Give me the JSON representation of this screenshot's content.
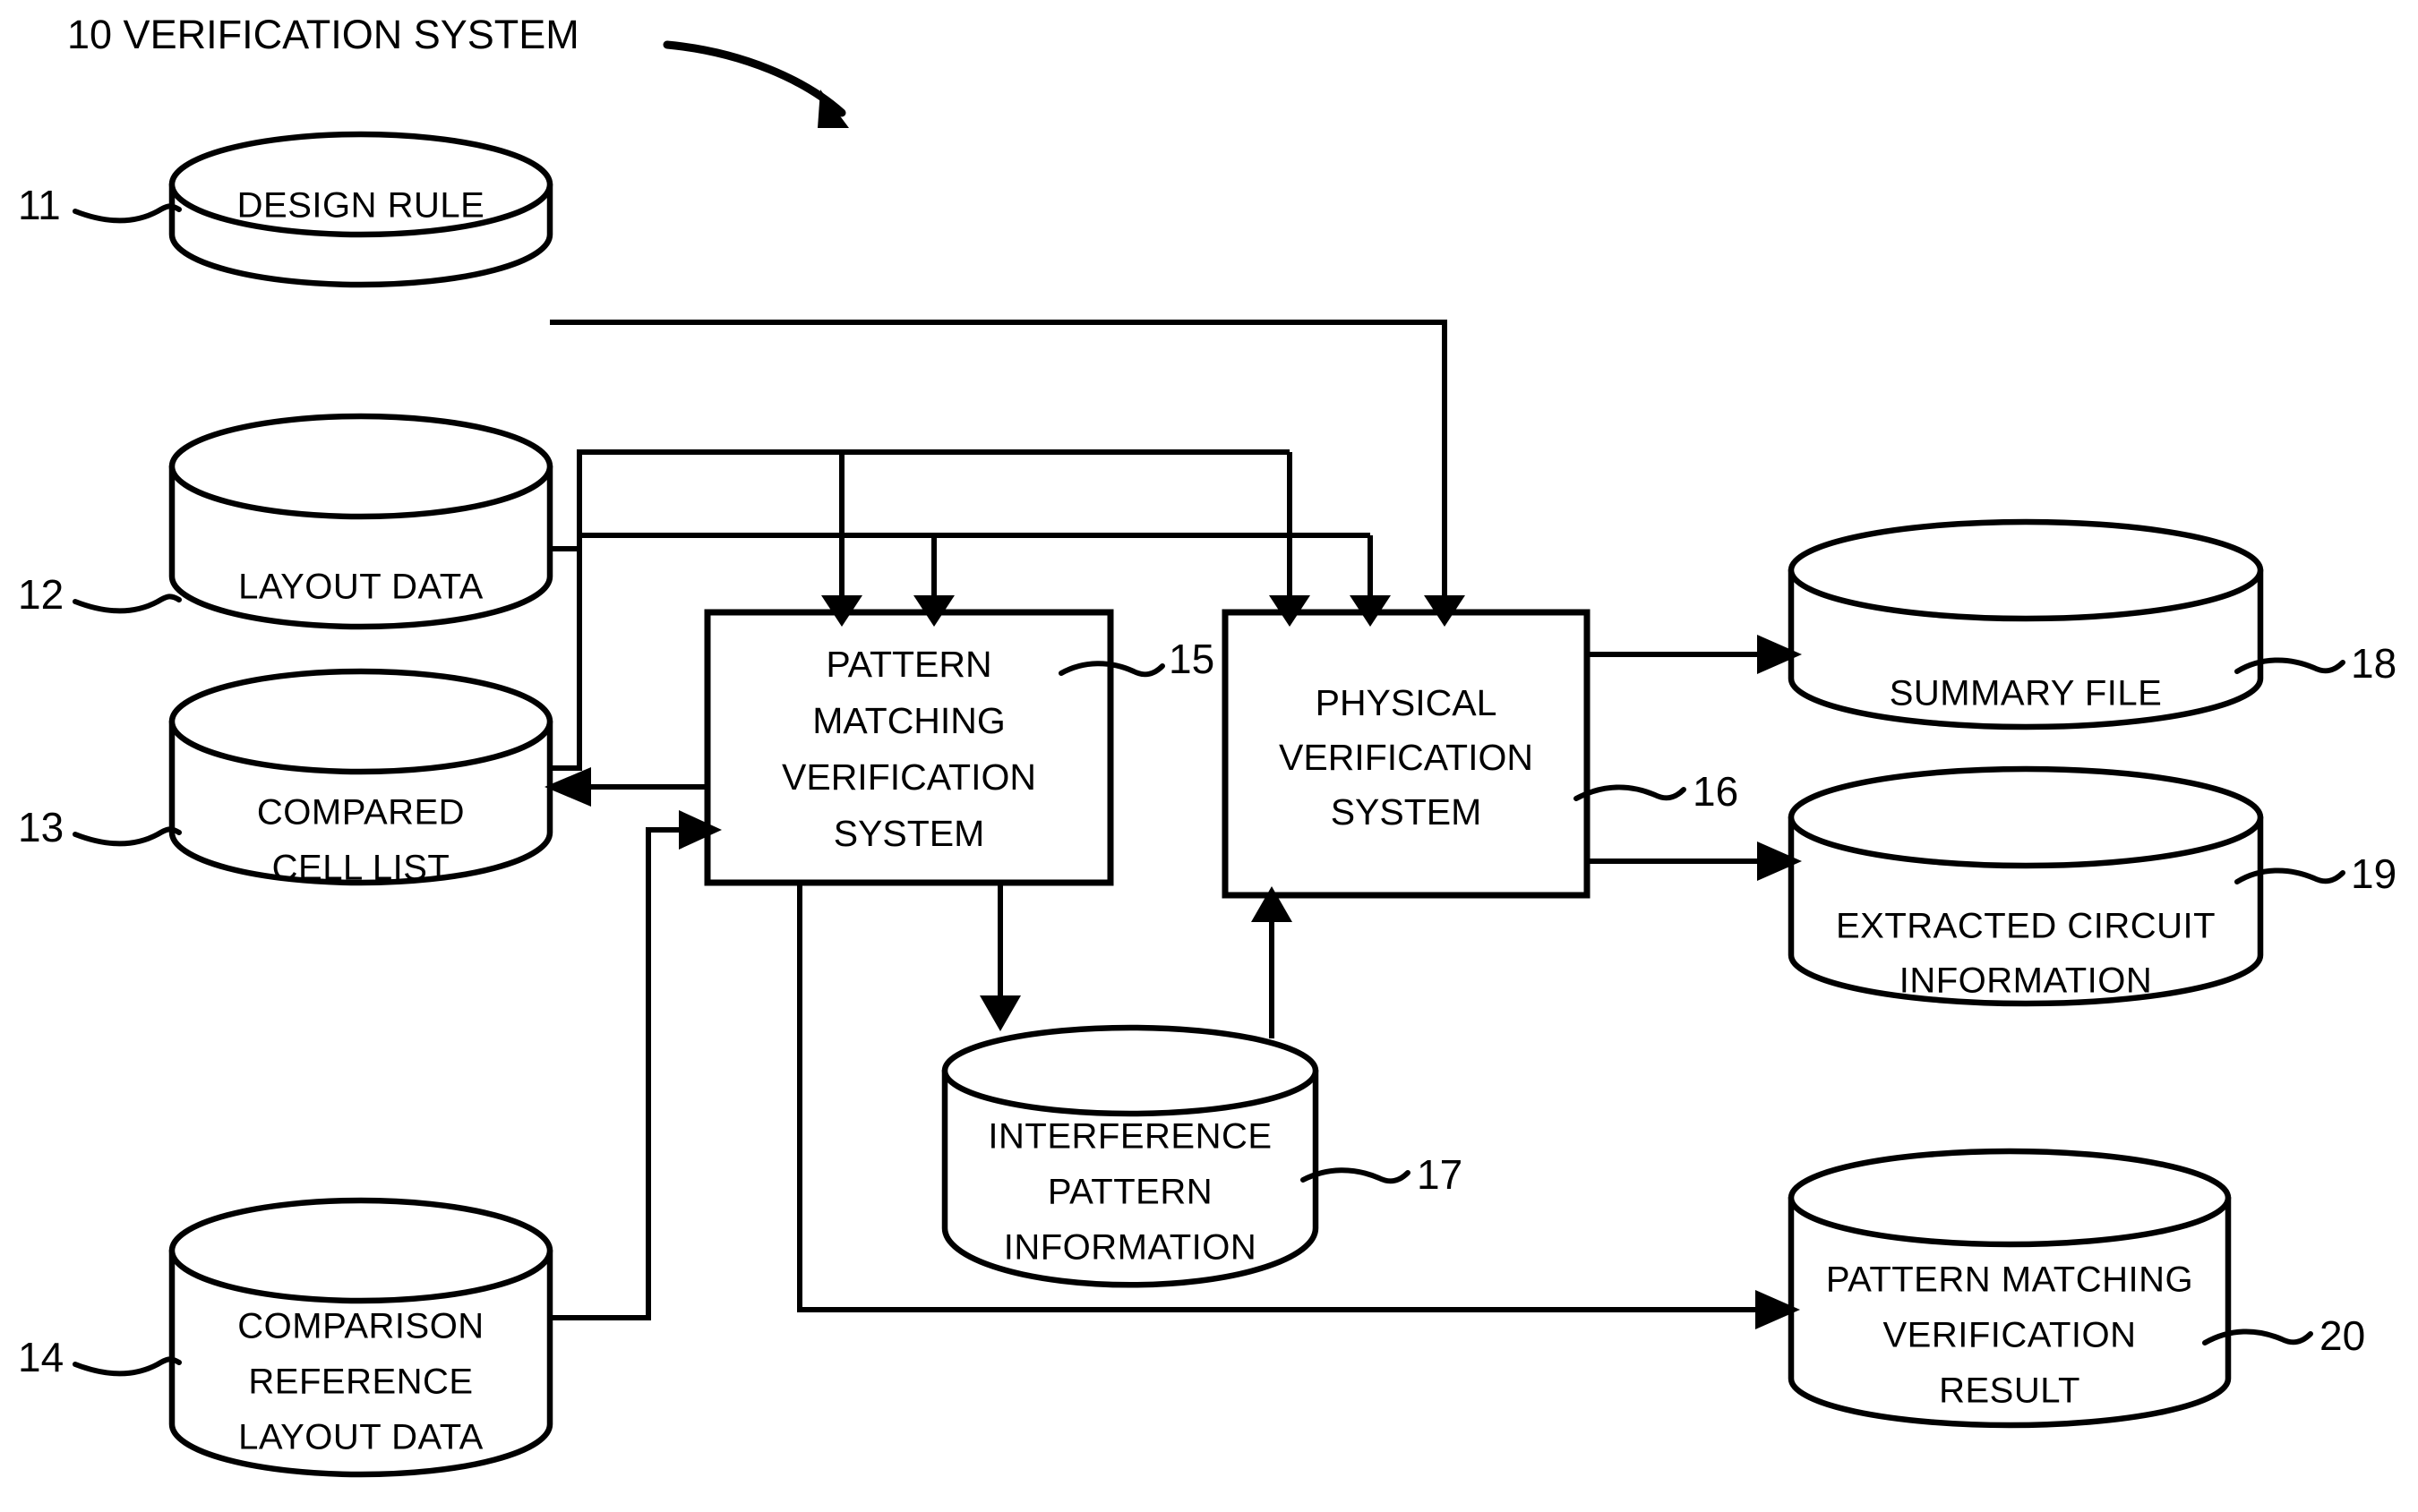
{
  "figure": {
    "title_ref": "10",
    "title_label": "VERIFICATION SYSTEM",
    "title_full": "10  VERIFICATION SYSTEM",
    "colors": {
      "stroke": "#000000",
      "fill": "#ffffff",
      "background": "#ffffff"
    }
  },
  "nodes": [
    {
      "ref": "11",
      "kind": "datastore",
      "shape": "cylinder",
      "label_lines": [
        "DESIGN RULE"
      ],
      "label": "DESIGN RULE"
    },
    {
      "ref": "12",
      "kind": "datastore",
      "shape": "cylinder",
      "label_lines": [
        "LAYOUT DATA"
      ],
      "label": "LAYOUT DATA"
    },
    {
      "ref": "13",
      "kind": "datastore",
      "shape": "cylinder",
      "label_lines": [
        "COMPARED",
        "CELL LIST"
      ],
      "label": "COMPARED CELL LIST"
    },
    {
      "ref": "14",
      "kind": "datastore",
      "shape": "cylinder",
      "label_lines": [
        "COMPARISON",
        "REFERENCE",
        "LAYOUT DATA"
      ],
      "label": "COMPARISON REFERENCE LAYOUT DATA"
    },
    {
      "ref": "15",
      "kind": "process",
      "shape": "rectangle",
      "label_lines": [
        "PATTERN",
        "MATCHING",
        "VERIFICATION",
        "SYSTEM"
      ],
      "label": "PATTERN MATCHING VERIFICATION SYSTEM"
    },
    {
      "ref": "16",
      "kind": "process",
      "shape": "rectangle",
      "label_lines": [
        "PHYSICAL",
        "VERIFICATION",
        "SYSTEM"
      ],
      "label": "PHYSICAL VERIFICATION SYSTEM"
    },
    {
      "ref": "17",
      "kind": "datastore",
      "shape": "cylinder",
      "label_lines": [
        "INTERFERENCE",
        "PATTERN",
        "INFORMATION"
      ],
      "label": "INTERFERENCE PATTERN INFORMATION"
    },
    {
      "ref": "18",
      "kind": "datastore",
      "shape": "cylinder",
      "label_lines": [
        "SUMMARY FILE"
      ],
      "label": "SUMMARY FILE"
    },
    {
      "ref": "19",
      "kind": "datastore",
      "shape": "cylinder",
      "label_lines": [
        "EXTRACTED CIRCUIT",
        "INFORMATION"
      ],
      "label": "EXTRACTED CIRCUIT INFORMATION"
    },
    {
      "ref": "20",
      "kind": "datastore",
      "shape": "cylinder",
      "label_lines": [
        "PATTERN MATCHING",
        "VERIFICATION",
        "RESULT"
      ],
      "label": "PATTERN MATCHING VERIFICATION RESULT"
    }
  ],
  "edges": [
    {
      "from": "11",
      "to": "16",
      "arrow": true
    },
    {
      "from": "12",
      "to": "15",
      "arrow": true
    },
    {
      "from": "12",
      "to": "16",
      "arrow": true
    },
    {
      "from": "13",
      "to": "15",
      "arrow": true
    },
    {
      "from": "13",
      "to": "16",
      "arrow": true
    },
    {
      "from": "14",
      "to": "15",
      "arrow": true
    },
    {
      "from": "15",
      "to": "13",
      "arrow": true
    },
    {
      "from": "15",
      "to": "17",
      "arrow": true
    },
    {
      "from": "15",
      "to": "20",
      "arrow": true
    },
    {
      "from": "17",
      "to": "16",
      "arrow": true
    },
    {
      "from": "16",
      "to": "18",
      "arrow": true
    },
    {
      "from": "16",
      "to": "19",
      "arrow": true
    }
  ]
}
